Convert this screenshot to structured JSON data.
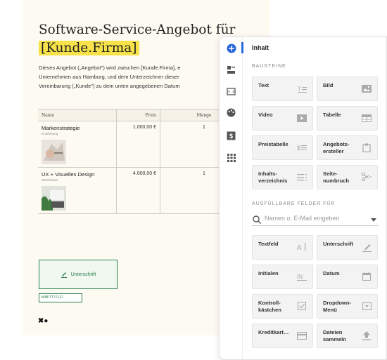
{
  "document": {
    "title_line1": "Software-Service-Angebot für",
    "title_line2": "[Kunde.Firma]",
    "intro": "Dieses Angebot („Angebot\") wird zwischen [Kunde.Firma], e\nUnternehmen aus Hamburg, und dem Unterzeichner dieser\nVereinbarung („Kunde\") zu dem unten angegebenen Datum",
    "table": {
      "headers": [
        "Name",
        "Preis",
        "Menge"
      ],
      "rows": [
        {
          "name": "Markenstrategie",
          "sub": "Entstehung",
          "price": "1.000,00 €",
          "qty": "1"
        },
        {
          "name": "UX + Visuelles Design",
          "sub": "Wireframes",
          "price": "4.000,00 €",
          "qty": "1"
        }
      ]
    },
    "signature_label": "Unterschrift",
    "date_placeholder": "MM/TT/JJJJ",
    "logo_text": "✖●"
  },
  "panel": {
    "title": "Inhalt",
    "bausteine_heading": "BAUSTEINE",
    "bausteine": [
      {
        "label": "Text",
        "icon": "text-format-icon"
      },
      {
        "label": "Bild",
        "icon": "image-icon"
      },
      {
        "label": "Video",
        "icon": "video-play-icon"
      },
      {
        "label": "Tabelle",
        "icon": "table-icon"
      },
      {
        "label": "Preistabelle",
        "icon": "price-list-icon"
      },
      {
        "label": "Angebots-\nersteller",
        "icon": "quote-builder-icon"
      },
      {
        "label": "Inhalts-\nverzeichnis",
        "icon": "toc-icon"
      },
      {
        "label": "Seite-\nnumbruch",
        "icon": "page-break-scissors-icon"
      }
    ],
    "fields_heading": "AUSFÜLLBARE FELDER FÜR",
    "search_placeholder": "Namen o. E-Mail eingeben",
    "fields": [
      {
        "label": "Textfeld",
        "icon": "text-field-icon"
      },
      {
        "label": "Unterschrift",
        "icon": "pen-icon"
      },
      {
        "label": "Initialen",
        "icon": "initials-icon"
      },
      {
        "label": "Datum",
        "icon": "calendar-icon"
      },
      {
        "label": "Kontroll-\nkästchen",
        "icon": "checkbox-icon"
      },
      {
        "label": "Dropdown-\nMenü",
        "icon": "dropdown-icon"
      },
      {
        "label": "Kreditkart…",
        "icon": "credit-card-icon"
      },
      {
        "label": "Dateien\nsammeln",
        "icon": "upload-icon"
      }
    ]
  },
  "colors": {
    "accent": "#2b68d8",
    "highlight": "#f7e24a",
    "signature_green": "#2e7d4f"
  }
}
